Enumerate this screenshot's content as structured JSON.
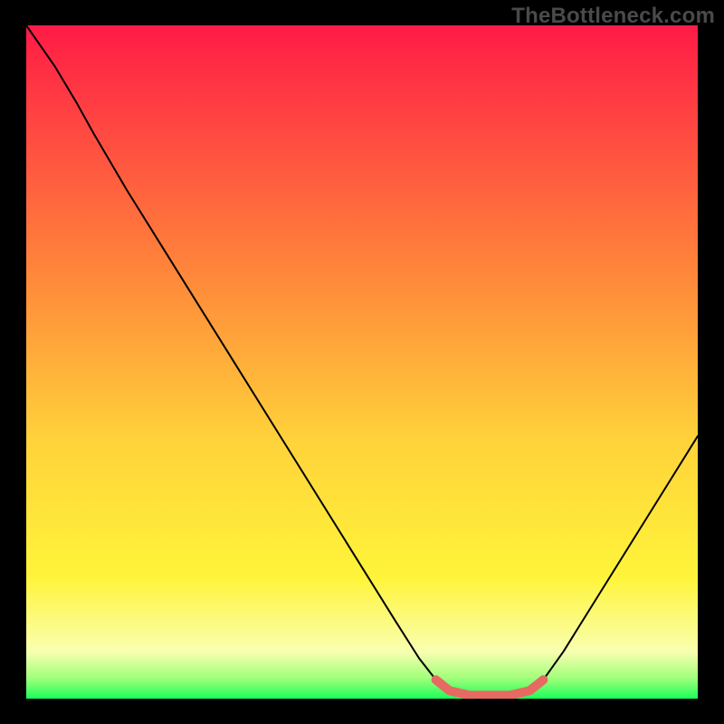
{
  "watermark": "TheBottleneck.com",
  "chart_data": {
    "type": "line",
    "title": "",
    "xlabel": "",
    "ylabel": "",
    "xlim": [
      0,
      100
    ],
    "ylim": [
      0,
      100
    ],
    "grid": false,
    "background": "vertical-gradient red→orange→yellow→pale-yellow→green",
    "gradient_stops": [
      {
        "pos": 0.0,
        "color": "#ff1b46"
      },
      {
        "pos": 0.38,
        "color": "#ff8a3a"
      },
      {
        "pos": 0.62,
        "color": "#ffd33a"
      },
      {
        "pos": 0.82,
        "color": "#fff43a"
      },
      {
        "pos": 0.93,
        "color": "#f9ffb0"
      },
      {
        "pos": 0.97,
        "color": "#9fff7a"
      },
      {
        "pos": 1.0,
        "color": "#1bff5a"
      }
    ],
    "series": [
      {
        "name": "curve",
        "style": "black-thin",
        "points": [
          {
            "x": 0.0,
            "y": 100.0
          },
          {
            "x": 4.2,
            "y": 94.0
          },
          {
            "x": 7.5,
            "y": 88.5
          },
          {
            "x": 10.0,
            "y": 84.0
          },
          {
            "x": 15.0,
            "y": 75.5
          },
          {
            "x": 20.0,
            "y": 67.5
          },
          {
            "x": 25.0,
            "y": 59.5
          },
          {
            "x": 30.0,
            "y": 51.5
          },
          {
            "x": 35.0,
            "y": 43.5
          },
          {
            "x": 40.0,
            "y": 35.5
          },
          {
            "x": 45.0,
            "y": 27.5
          },
          {
            "x": 50.0,
            "y": 19.5
          },
          {
            "x": 55.0,
            "y": 11.5
          },
          {
            "x": 58.5,
            "y": 6.0
          },
          {
            "x": 61.0,
            "y": 2.8
          },
          {
            "x": 63.0,
            "y": 1.2
          },
          {
            "x": 66.0,
            "y": 0.5
          },
          {
            "x": 72.0,
            "y": 0.5
          },
          {
            "x": 75.0,
            "y": 1.2
          },
          {
            "x": 77.0,
            "y": 2.8
          },
          {
            "x": 80.0,
            "y": 7.0
          },
          {
            "x": 85.0,
            "y": 15.0
          },
          {
            "x": 90.0,
            "y": 23.0
          },
          {
            "x": 95.0,
            "y": 31.0
          },
          {
            "x": 100.0,
            "y": 39.0
          }
        ]
      },
      {
        "name": "valley-highlight",
        "style": "salmon-thick",
        "points": [
          {
            "x": 61.0,
            "y": 2.8
          },
          {
            "x": 63.0,
            "y": 1.2
          },
          {
            "x": 66.0,
            "y": 0.5
          },
          {
            "x": 72.0,
            "y": 0.5
          },
          {
            "x": 75.0,
            "y": 1.2
          },
          {
            "x": 77.0,
            "y": 2.8
          }
        ]
      }
    ]
  }
}
